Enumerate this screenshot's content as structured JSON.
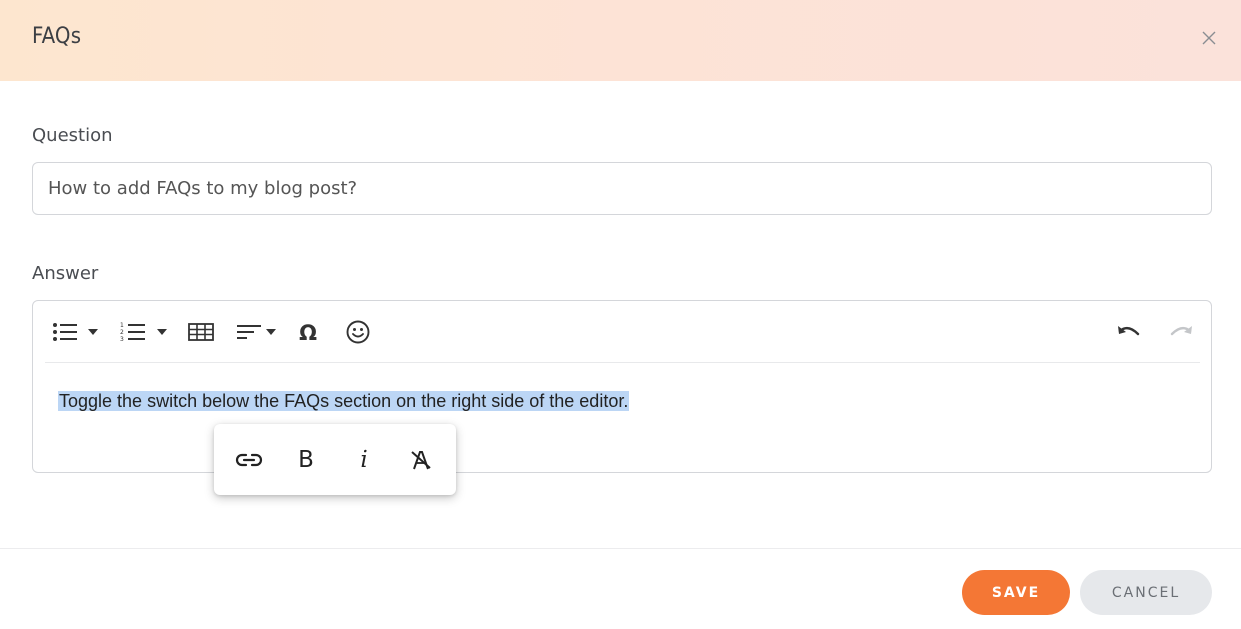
{
  "header": {
    "title": "FAQs",
    "close_icon": "close-icon"
  },
  "question": {
    "label": "Question",
    "value": "How to add FAQs to my blog post?"
  },
  "answer": {
    "label": "Answer",
    "toolbar": {
      "items": [
        "bulleted-list-icon",
        "caret-down-icon",
        "numbered-list-icon",
        "caret-down-icon",
        "table-icon",
        "align-icon",
        "caret-down-icon",
        "omega-icon",
        "emoji-icon",
        "undo-icon",
        "redo-icon"
      ]
    },
    "content": "Toggle the switch below the FAQs section on the right side of the editor."
  },
  "inline_toolbar": {
    "link_icon": "link-icon",
    "bold_label": "B",
    "italic_label": "i",
    "clear_format_icon": "clear-format-icon"
  },
  "footer": {
    "save_label": "SAVE",
    "cancel_label": "CANCEL"
  },
  "colors": {
    "accent": "#f47735",
    "header_gradient_start": "#fde6cf",
    "header_gradient_end": "#fbe2da",
    "selection": "#bcd6f5",
    "cancel_bg": "#e6e8eb"
  }
}
